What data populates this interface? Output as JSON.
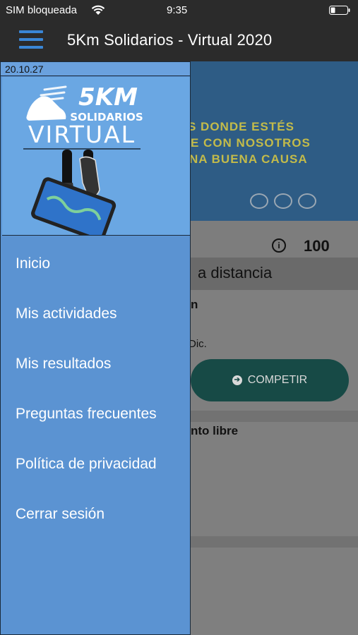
{
  "status_bar": {
    "carrier": "SIM bloqueada",
    "time": "9:35"
  },
  "nav": {
    "title": "5Km Solidarios - Virtual 2020"
  },
  "background": {
    "hero_lines": [
      "S DONDE ESTÉS",
      "E CON NOSOTROS",
      "NA BUENA CAUSA"
    ],
    "points": "100",
    "section_title": "a distancia",
    "card1_subtitle": "n",
    "card1_date": "Dic.",
    "compete_label": "COMPETIR",
    "card2_subtitle": "nto libre"
  },
  "drawer": {
    "version": "20.10.27",
    "logo": {
      "line1": "5KM",
      "line2": "SOLIDARIOS",
      "line3": "VIRTUAL"
    },
    "menu": [
      {
        "label": "Inicio"
      },
      {
        "label": "Mis actividades"
      },
      {
        "label": "Mis resultados"
      },
      {
        "label": "Preguntas frecuentes"
      },
      {
        "label": "Política de privacidad"
      },
      {
        "label": "Cerrar sesión"
      }
    ]
  },
  "colors": {
    "drawer_bg": "#5b93d2",
    "accent": "#3a86d6",
    "compete_bg": "#174a46"
  }
}
